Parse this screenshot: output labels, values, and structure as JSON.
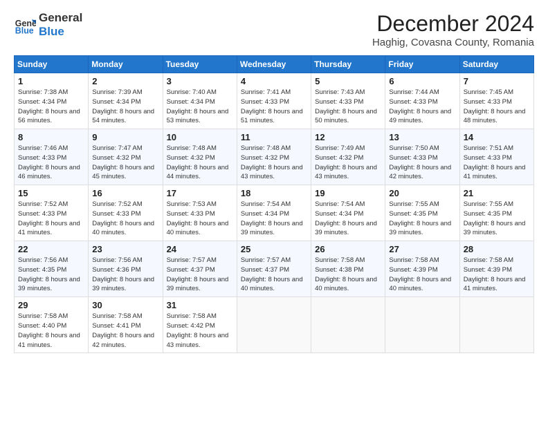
{
  "header": {
    "logo_line1": "General",
    "logo_line2": "Blue",
    "month_year": "December 2024",
    "location": "Haghig, Covasna County, Romania"
  },
  "days_of_week": [
    "Sunday",
    "Monday",
    "Tuesday",
    "Wednesday",
    "Thursday",
    "Friday",
    "Saturday"
  ],
  "weeks": [
    [
      {
        "day": 1,
        "sunrise": "7:38 AM",
        "sunset": "4:34 PM",
        "daylight": "8 hours and 56 minutes."
      },
      {
        "day": 2,
        "sunrise": "7:39 AM",
        "sunset": "4:34 PM",
        "daylight": "8 hours and 54 minutes."
      },
      {
        "day": 3,
        "sunrise": "7:40 AM",
        "sunset": "4:34 PM",
        "daylight": "8 hours and 53 minutes."
      },
      {
        "day": 4,
        "sunrise": "7:41 AM",
        "sunset": "4:33 PM",
        "daylight": "8 hours and 51 minutes."
      },
      {
        "day": 5,
        "sunrise": "7:43 AM",
        "sunset": "4:33 PM",
        "daylight": "8 hours and 50 minutes."
      },
      {
        "day": 6,
        "sunrise": "7:44 AM",
        "sunset": "4:33 PM",
        "daylight": "8 hours and 49 minutes."
      },
      {
        "day": 7,
        "sunrise": "7:45 AM",
        "sunset": "4:33 PM",
        "daylight": "8 hours and 48 minutes."
      }
    ],
    [
      {
        "day": 8,
        "sunrise": "7:46 AM",
        "sunset": "4:33 PM",
        "daylight": "8 hours and 46 minutes."
      },
      {
        "day": 9,
        "sunrise": "7:47 AM",
        "sunset": "4:32 PM",
        "daylight": "8 hours and 45 minutes."
      },
      {
        "day": 10,
        "sunrise": "7:48 AM",
        "sunset": "4:32 PM",
        "daylight": "8 hours and 44 minutes."
      },
      {
        "day": 11,
        "sunrise": "7:48 AM",
        "sunset": "4:32 PM",
        "daylight": "8 hours and 43 minutes."
      },
      {
        "day": 12,
        "sunrise": "7:49 AM",
        "sunset": "4:32 PM",
        "daylight": "8 hours and 43 minutes."
      },
      {
        "day": 13,
        "sunrise": "7:50 AM",
        "sunset": "4:33 PM",
        "daylight": "8 hours and 42 minutes."
      },
      {
        "day": 14,
        "sunrise": "7:51 AM",
        "sunset": "4:33 PM",
        "daylight": "8 hours and 41 minutes."
      }
    ],
    [
      {
        "day": 15,
        "sunrise": "7:52 AM",
        "sunset": "4:33 PM",
        "daylight": "8 hours and 41 minutes."
      },
      {
        "day": 16,
        "sunrise": "7:52 AM",
        "sunset": "4:33 PM",
        "daylight": "8 hours and 40 minutes."
      },
      {
        "day": 17,
        "sunrise": "7:53 AM",
        "sunset": "4:33 PM",
        "daylight": "8 hours and 40 minutes."
      },
      {
        "day": 18,
        "sunrise": "7:54 AM",
        "sunset": "4:34 PM",
        "daylight": "8 hours and 39 minutes."
      },
      {
        "day": 19,
        "sunrise": "7:54 AM",
        "sunset": "4:34 PM",
        "daylight": "8 hours and 39 minutes."
      },
      {
        "day": 20,
        "sunrise": "7:55 AM",
        "sunset": "4:35 PM",
        "daylight": "8 hours and 39 minutes."
      },
      {
        "day": 21,
        "sunrise": "7:55 AM",
        "sunset": "4:35 PM",
        "daylight": "8 hours and 39 minutes."
      }
    ],
    [
      {
        "day": 22,
        "sunrise": "7:56 AM",
        "sunset": "4:35 PM",
        "daylight": "8 hours and 39 minutes."
      },
      {
        "day": 23,
        "sunrise": "7:56 AM",
        "sunset": "4:36 PM",
        "daylight": "8 hours and 39 minutes."
      },
      {
        "day": 24,
        "sunrise": "7:57 AM",
        "sunset": "4:37 PM",
        "daylight": "8 hours and 39 minutes."
      },
      {
        "day": 25,
        "sunrise": "7:57 AM",
        "sunset": "4:37 PM",
        "daylight": "8 hours and 40 minutes."
      },
      {
        "day": 26,
        "sunrise": "7:58 AM",
        "sunset": "4:38 PM",
        "daylight": "8 hours and 40 minutes."
      },
      {
        "day": 27,
        "sunrise": "7:58 AM",
        "sunset": "4:39 PM",
        "daylight": "8 hours and 40 minutes."
      },
      {
        "day": 28,
        "sunrise": "7:58 AM",
        "sunset": "4:39 PM",
        "daylight": "8 hours and 41 minutes."
      }
    ],
    [
      {
        "day": 29,
        "sunrise": "7:58 AM",
        "sunset": "4:40 PM",
        "daylight": "8 hours and 41 minutes."
      },
      {
        "day": 30,
        "sunrise": "7:58 AM",
        "sunset": "4:41 PM",
        "daylight": "8 hours and 42 minutes."
      },
      {
        "day": 31,
        "sunrise": "7:58 AM",
        "sunset": "4:42 PM",
        "daylight": "8 hours and 43 minutes."
      },
      null,
      null,
      null,
      null
    ]
  ]
}
